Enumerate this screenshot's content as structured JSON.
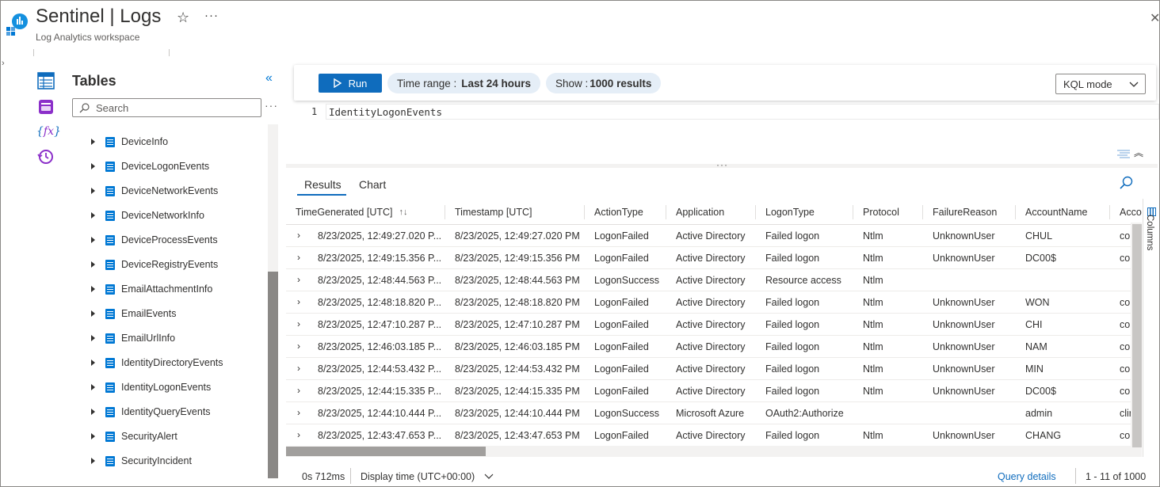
{
  "header": {
    "title": "Sentinel | Logs",
    "subtitle": "Log Analytics workspace"
  },
  "tables_pane": {
    "title": "Tables",
    "search_placeholder": "Search",
    "items": [
      {
        "label": "DeviceInfo"
      },
      {
        "label": "DeviceLogonEvents"
      },
      {
        "label": "DeviceNetworkEvents"
      },
      {
        "label": "DeviceNetworkInfo"
      },
      {
        "label": "DeviceProcessEvents"
      },
      {
        "label": "DeviceRegistryEvents"
      },
      {
        "label": "EmailAttachmentInfo"
      },
      {
        "label": "EmailEvents"
      },
      {
        "label": "EmailUrlInfo"
      },
      {
        "label": "IdentityDirectoryEvents"
      },
      {
        "label": "IdentityLogonEvents"
      },
      {
        "label": "IdentityQueryEvents"
      },
      {
        "label": "SecurityAlert"
      },
      {
        "label": "SecurityIncident"
      }
    ]
  },
  "toolbar": {
    "run_label": "Run",
    "time_range_label": "Time range :",
    "time_range_value": "Last 24 hours",
    "show_label": "Show :",
    "show_value": "1000 results",
    "mode_value": "KQL mode"
  },
  "editor": {
    "line_number": "1",
    "query": "IdentityLogonEvents"
  },
  "results": {
    "tabs": [
      "Results",
      "Chart"
    ],
    "active_tab": "Results",
    "columns": [
      "TimeGenerated [UTC]",
      "Timestamp [UTC]",
      "ActionType",
      "Application",
      "LogonType",
      "Protocol",
      "FailureReason",
      "AccountName",
      "Accou"
    ],
    "rows": [
      [
        "8/23/2025, 12:49:27.020 P...",
        "8/23/2025, 12:49:27.020 PM",
        "LogonFailed",
        "Active Directory",
        "Failed logon",
        "Ntlm",
        "UnknownUser",
        "CHUL",
        "cor"
      ],
      [
        "8/23/2025, 12:49:15.356 P...",
        "8/23/2025, 12:49:15.356 PM",
        "LogonFailed",
        "Active Directory",
        "Failed logon",
        "Ntlm",
        "UnknownUser",
        "DC00$",
        "cor"
      ],
      [
        "8/23/2025, 12:48:44.563 P...",
        "8/23/2025, 12:48:44.563 PM",
        "LogonSuccess",
        "Active Directory",
        "Resource access",
        "Ntlm",
        "",
        "",
        ""
      ],
      [
        "8/23/2025, 12:48:18.820 P...",
        "8/23/2025, 12:48:18.820 PM",
        "LogonFailed",
        "Active Directory",
        "Failed logon",
        "Ntlm",
        "UnknownUser",
        "WON",
        "cor"
      ],
      [
        "8/23/2025, 12:47:10.287 P...",
        "8/23/2025, 12:47:10.287 PM",
        "LogonFailed",
        "Active Directory",
        "Failed logon",
        "Ntlm",
        "UnknownUser",
        "CHI",
        "cor"
      ],
      [
        "8/23/2025, 12:46:03.185 P...",
        "8/23/2025, 12:46:03.185 PM",
        "LogonFailed",
        "Active Directory",
        "Failed logon",
        "Ntlm",
        "UnknownUser",
        "NAM",
        "cor"
      ],
      [
        "8/23/2025, 12:44:53.432 P...",
        "8/23/2025, 12:44:53.432 PM",
        "LogonFailed",
        "Active Directory",
        "Failed logon",
        "Ntlm",
        "UnknownUser",
        "MIN",
        "cor"
      ],
      [
        "8/23/2025, 12:44:15.335 P...",
        "8/23/2025, 12:44:15.335 PM",
        "LogonFailed",
        "Active Directory",
        "Failed logon",
        "Ntlm",
        "UnknownUser",
        "DC00$",
        "cor"
      ],
      [
        "8/23/2025, 12:44:10.444 P...",
        "8/23/2025, 12:44:10.444 PM",
        "LogonSuccess",
        "Microsoft Azure",
        "OAuth2:Authorize",
        "",
        "",
        "admin",
        "clir"
      ],
      [
        "8/23/2025, 12:43:47.653 P...",
        "8/23/2025, 12:43:47.653 PM",
        "LogonFailed",
        "Active Directory",
        "Failed logon",
        "Ntlm",
        "UnknownUser",
        "CHANG",
        "cor"
      ]
    ],
    "columns_panel_label": "Columns"
  },
  "status_bar": {
    "duration": "0s 712ms",
    "display_time": "Display time (UTC+00:00)",
    "query_details": "Query details",
    "pagination": "1 - 11 of 1000"
  },
  "colors": {
    "accent": "#0f6cbd",
    "pill_bg": "#e5eef7",
    "table_icon": "#0078d4"
  },
  "icons": {
    "app_logo": "log-analytics-icon",
    "favorite": "star-icon",
    "more": "ellipsis-icon",
    "close": "close-icon",
    "rail": [
      "tables-icon",
      "queries-icon",
      "functions-icon",
      "history-icon"
    ],
    "collapse": "double-chevron-left-icon",
    "search": "search-icon",
    "sort": "sort-icon",
    "columns": "columns-icon"
  }
}
